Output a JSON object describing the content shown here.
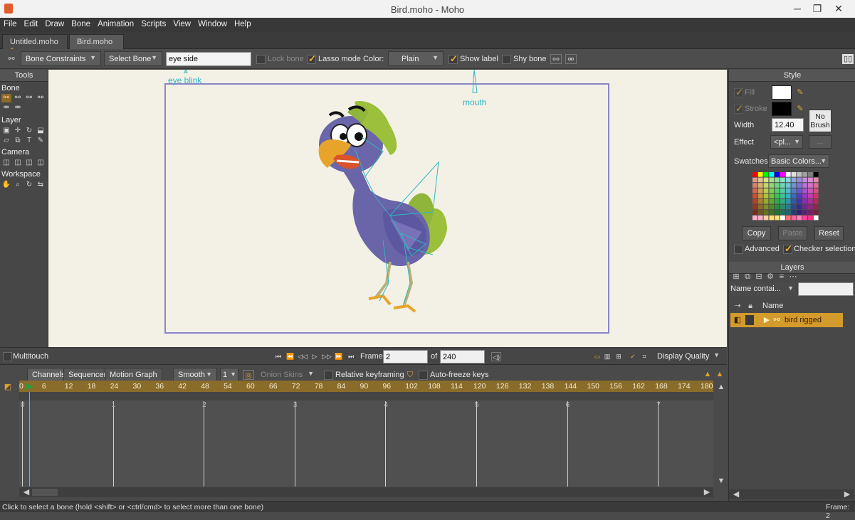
{
  "window": {
    "title": "Bird.moho - Moho"
  },
  "menu": [
    "File",
    "Edit",
    "Draw",
    "Bone",
    "Animation",
    "Scripts",
    "View",
    "Window",
    "Help"
  ],
  "doc_tabs": [
    "Untitled.moho",
    "Bird.moho"
  ],
  "options": {
    "constraints_dropdown": "Bone Constraints",
    "select_bone_dropdown": "Select Bone",
    "bone_name_value": "eye side",
    "lock_bone_label": "Lock bone",
    "lasso_label": "Lasso mode",
    "color_label": "Color:",
    "color_value": "Plain",
    "show_label": "Show label",
    "shy_bone_label": "Shy bone"
  },
  "tools": {
    "title": "Tools",
    "sections": [
      "Bone",
      "Layer",
      "Camera",
      "Workspace"
    ]
  },
  "canvas": {
    "bone_labels": [
      "eye blink",
      "mouth"
    ]
  },
  "style": {
    "title": "Style",
    "fill_label": "Fill",
    "stroke_label": "Stroke",
    "width_label": "Width",
    "width_value": "12.40",
    "no_brush_label": "No Brush",
    "effect_label": "Effect",
    "effect_value": "<pl...",
    "effect_more": "...",
    "swatches_label": "Swatches",
    "swatches_value": "Basic Colors...",
    "copy_label": "Copy",
    "paste_label": "Paste",
    "reset_label": "Reset",
    "advanced_label": "Advanced",
    "checker_label": "Checker selection",
    "fill_color": "#ffffff",
    "stroke_color": "#000000"
  },
  "layers": {
    "title": "Layers",
    "filter_dropdown": "Name contai...",
    "name_column": "Name",
    "items": [
      {
        "name": "bird rigged"
      }
    ]
  },
  "transport": {
    "multitouch_label": "Multitouch",
    "frame_label": "Frame",
    "frame_value": "2",
    "of_label": "of",
    "total_frames": "240",
    "display_quality_label": "Display Quality"
  },
  "timeline": {
    "tabs": [
      "Channels",
      "Sequencer",
      "Motion Graph"
    ],
    "interp_value": "Smooth",
    "interval_value": "1",
    "onion_label": "Onion Skins",
    "relative_label": "Relative keyframing",
    "autofreeze_label": "Auto-freeze keys",
    "ruler": [
      "0",
      "6",
      "12",
      "18",
      "24",
      "30",
      "36",
      "42",
      "48",
      "54",
      "60",
      "66",
      "72",
      "78",
      "84",
      "90",
      "96",
      "102",
      "108",
      "114",
      "120",
      "126",
      "132",
      "138",
      "144",
      "150",
      "156",
      "162",
      "168",
      "174",
      "180"
    ],
    "seconds": [
      "0",
      "1",
      "2",
      "3",
      "4",
      "5",
      "6",
      "7"
    ]
  },
  "status": {
    "hint": "Click to select a bone (hold <shift> or <ctrl/cmd> to select more than one bone)",
    "frame_text": "Frame: 2"
  },
  "colors": {
    "accent": "#d39a2c",
    "canvas_bg": "#f3f1e6",
    "frame_border": "#8a86c8",
    "bone": "#2fb7c2"
  }
}
